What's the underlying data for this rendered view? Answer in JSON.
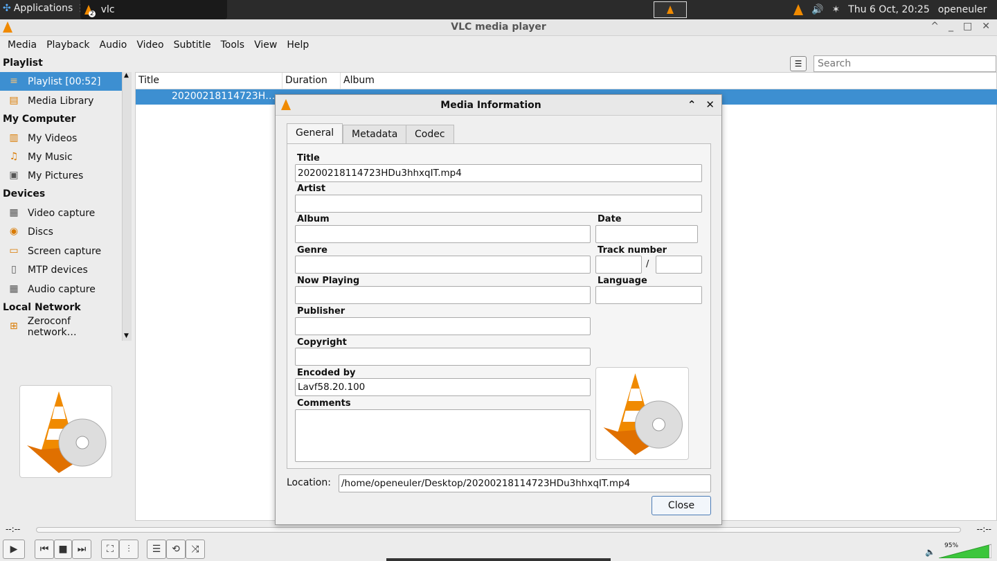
{
  "taskbar": {
    "applications": "Applications",
    "window_label": "vlc",
    "window_badge": "2",
    "datetime": "Thu  6 Oct, 20:25",
    "user": "openeuler"
  },
  "window": {
    "title": "VLC media player",
    "controls": [
      "^",
      "_",
      "□",
      "✕"
    ]
  },
  "menu": [
    "Media",
    "Playback",
    "Audio",
    "Video",
    "Subtitle",
    "Tools",
    "View",
    "Help"
  ],
  "playlist": {
    "label": "Playlist",
    "search_placeholder": "Search"
  },
  "sidebar": {
    "top_items": [
      {
        "label": "Playlist [00:52]",
        "icon": "playlist-icon",
        "selected": true
      },
      {
        "label": "Media Library",
        "icon": "library-icon"
      }
    ],
    "sections": [
      {
        "title": "My Computer",
        "items": [
          {
            "label": "My Videos",
            "icon": "film-icon"
          },
          {
            "label": "My Music",
            "icon": "music-icon"
          },
          {
            "label": "My Pictures",
            "icon": "picture-icon"
          }
        ]
      },
      {
        "title": "Devices",
        "items": [
          {
            "label": "Video capture",
            "icon": "capture-icon"
          },
          {
            "label": "Discs",
            "icon": "disc-icon"
          },
          {
            "label": "Screen capture",
            "icon": "screen-icon"
          },
          {
            "label": "MTP devices",
            "icon": "device-icon"
          },
          {
            "label": "Audio capture",
            "icon": "capture-icon"
          }
        ]
      },
      {
        "title": "Local Network",
        "items": [
          {
            "label": "Zeroconf network…",
            "icon": "network-icon"
          }
        ]
      }
    ]
  },
  "list": {
    "columns": [
      "Title",
      "Duration",
      "Album"
    ],
    "rows": [
      {
        "title": "20200218114723H…"
      }
    ]
  },
  "seek": {
    "elapsed": "--:--",
    "remaining": "--:--"
  },
  "volume": {
    "level": "95%",
    "value": 0.95
  },
  "dialog": {
    "title": "Media Information",
    "tabs": [
      "General",
      "Metadata",
      "Codec"
    ],
    "active_tab": "General",
    "fields": {
      "title_label": "Title",
      "title_value": "20200218114723HDu3hhxqIT.mp4",
      "artist_label": "Artist",
      "artist_value": "",
      "album_label": "Album",
      "album_value": "",
      "date_label": "Date",
      "date_value": "",
      "genre_label": "Genre",
      "genre_value": "",
      "track_label": "Track number",
      "track_value": "",
      "track_sep": "/",
      "track_total": "",
      "nowplaying_label": "Now Playing",
      "nowplaying_value": "",
      "language_label": "Language",
      "language_value": "",
      "publisher_label": "Publisher",
      "publisher_value": "",
      "copyright_label": "Copyright",
      "copyright_value": "",
      "encoded_label": "Encoded by",
      "encoded_value": "Lavf58.20.100",
      "comments_label": "Comments",
      "comments_value": ""
    },
    "location_label": "Location:",
    "location_value": "/home/openeuler/Desktop/20200218114723HDu3hhxqIT.mp4",
    "close_label": "Close"
  },
  "colors": {
    "accent": "#3d8fd1",
    "cone": "#f08a00",
    "taskbar": "#2b2b2b"
  }
}
